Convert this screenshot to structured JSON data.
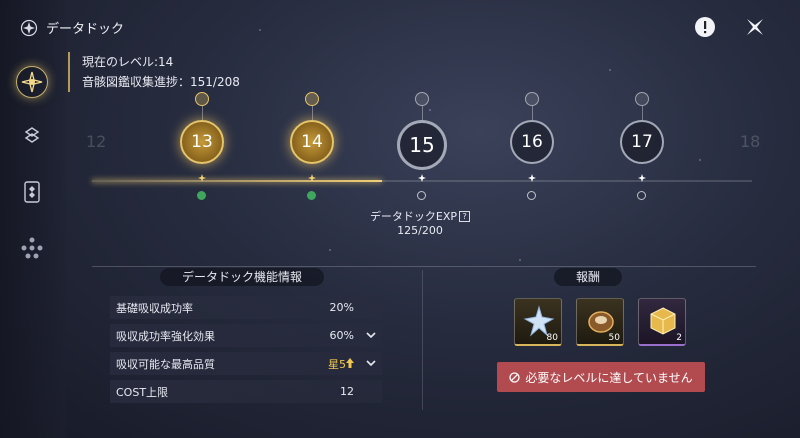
{
  "header": {
    "title": "データドック"
  },
  "info": {
    "level_line": "現在のレベル:14",
    "progress_line": "音骸図鑑収集進捗：151/208"
  },
  "timeline": {
    "ghost_left": "12",
    "ghost_right": "18",
    "nodes": [
      {
        "level": "13",
        "state": "done"
      },
      {
        "level": "14",
        "state": "done"
      },
      {
        "level": "15",
        "state": "current"
      },
      {
        "level": "16",
        "state": "locked"
      },
      {
        "level": "17",
        "state": "locked"
      }
    ],
    "fill_fraction": 0.44
  },
  "exp": {
    "label": "データドックEXP",
    "help": "?",
    "value": "125/200"
  },
  "features": {
    "title": "データドック機能情報",
    "rows": [
      {
        "label": "基礎吸収成功率",
        "value": "20%",
        "expandable": false
      },
      {
        "label": "吸収成功率強化効果",
        "value": "60%",
        "expandable": true
      },
      {
        "label": "吸収可能な最高品質",
        "value": "星5",
        "expandable": true,
        "highlight": true
      },
      {
        "label": "COST上限",
        "value": "12",
        "expandable": false
      }
    ]
  },
  "rewards": {
    "title": "報酬",
    "items": [
      {
        "icon": "crystal-star-icon",
        "count": "80",
        "rarity": "gold"
      },
      {
        "icon": "bronze-crest-icon",
        "count": "50",
        "rarity": "gold"
      },
      {
        "icon": "golden-cube-icon",
        "count": "2",
        "rarity": "purple"
      }
    ],
    "claim_label": "必要なレベルに達していません"
  },
  "colors": {
    "accent_gold": "#e6c46a",
    "claim_red": "#b24b50",
    "check_green": "#3fa65e"
  }
}
